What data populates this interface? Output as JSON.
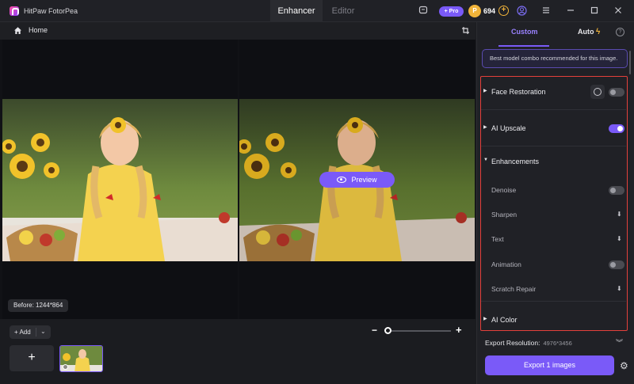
{
  "app": {
    "name": "HitPaw FotorPea"
  },
  "mode_tabs": [
    {
      "label": "Enhancer",
      "active": true
    },
    {
      "label": "Editor",
      "active": false
    }
  ],
  "titlebar": {
    "pro_label": "+ Pro",
    "coin_symbol": "P",
    "coin_count": "694",
    "coin_add": "+",
    "icons": [
      "chat-icon",
      "user-icon",
      "menu-icon",
      "minimize-icon",
      "maximize-icon",
      "close-icon"
    ]
  },
  "toolbar": {
    "home_label": "Home"
  },
  "preview": {
    "button_label": "Preview",
    "before_label": "Before: 1244*864"
  },
  "bottom": {
    "add_label": "+ Add",
    "add_caret": "⌄",
    "add_tile": "+",
    "zoom_minus": "−",
    "zoom_plus": "+",
    "zoom_level": 0.02
  },
  "panel": {
    "tabs": [
      {
        "label": "Custom",
        "active": true
      },
      {
        "label": "Auto",
        "active": false
      }
    ],
    "help": "?",
    "tip": "Best model combo recommended for this image.",
    "sections": {
      "face_restoration": {
        "label": "Face Restoration",
        "enabled": false
      },
      "ai_upscale": {
        "label": "AI Upscale",
        "enabled": true
      },
      "enhancements": {
        "label": "Enhancements",
        "items": {
          "denoise": {
            "label": "Denoise",
            "enabled": false
          },
          "sharpen": {
            "label": "Sharpen"
          },
          "text": {
            "label": "Text"
          },
          "animation": {
            "label": "Animation",
            "enabled": false
          },
          "scratch_repair": {
            "label": "Scratch Repair"
          }
        }
      },
      "ai_color": {
        "label": "AI Color"
      }
    },
    "export_resolution_label": "Export Resolution:",
    "export_resolution_value": "4976*3456",
    "export_button": "Export 1 images"
  },
  "colors": {
    "accent": "#7a5af8",
    "highlight_border": "#e4403b",
    "coin": "#f0b33a"
  }
}
